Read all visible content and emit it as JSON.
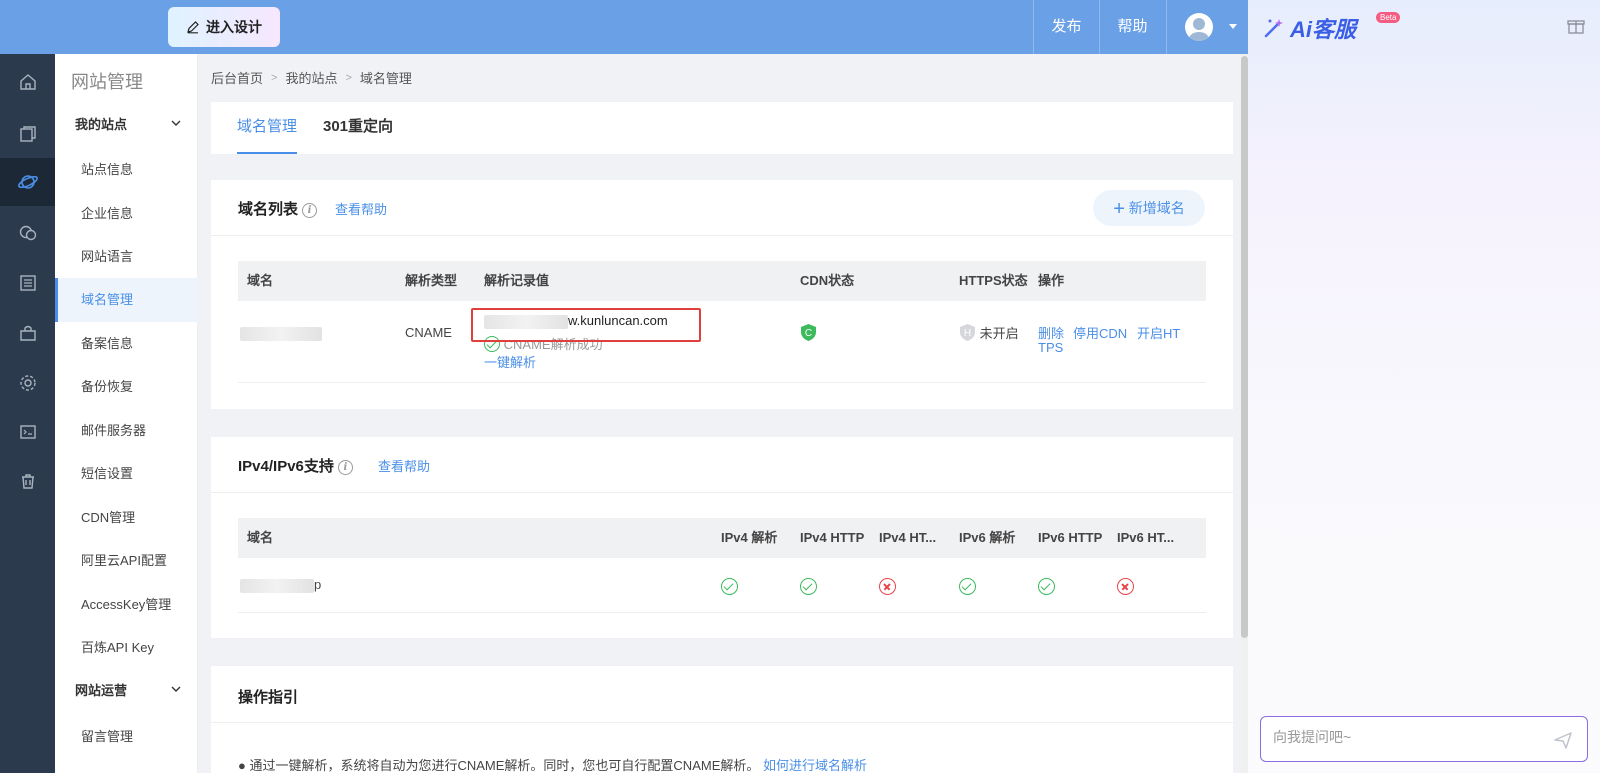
{
  "topbar": {
    "design_btn": "进入设计",
    "publish": "发布",
    "help": "帮助",
    "colors": {
      "bar": "#6aa0e6",
      "accent": "#4a8fe7"
    }
  },
  "iconbar": [
    "home-icon",
    "pages-icon",
    "planet-icon",
    "chat-icon",
    "list-icon",
    "store-icon",
    "gear-icon",
    "terminal-icon",
    "trash-icon"
  ],
  "subnav": {
    "title": "网站管理",
    "group1": "我的站点",
    "items": [
      "站点信息",
      "企业信息",
      "网站语言",
      "域名管理",
      "备案信息",
      "备份恢复",
      "邮件服务器",
      "短信设置",
      "CDN管理",
      "阿里云API配置",
      "AccessKey管理",
      "百炼API Key"
    ],
    "group2": "网站运营",
    "item_after": "留言管理"
  },
  "breadcrumb": [
    "后台首页",
    "我的站点",
    "域名管理"
  ],
  "tabs": [
    "域名管理",
    "301重定向"
  ],
  "domain_list": {
    "title": "域名列表",
    "help": "查看帮助",
    "add": "新增域名",
    "columns": [
      "域名",
      "解析类型",
      "解析记录值",
      "CDN状态",
      "HTTPS状态",
      "操作"
    ],
    "row": {
      "type": "CNAME",
      "record": "w.kunluncan.com",
      "status": "CNAME解析成功",
      "one_click": "一键解析",
      "cdn_badge": "C",
      "https_badge": "H",
      "https_state": "未开启",
      "actions": [
        "删除",
        "停用CDN",
        "开启HT",
        "TPS"
      ]
    }
  },
  "ipv": {
    "title": "IPv4/IPv6支持",
    "help": "查看帮助",
    "columns": [
      "域名",
      "IPv4 解析",
      "IPv4 HTTP",
      "IPv4 HT...",
      "IPv6 解析",
      "IPv6 HTTP",
      "IPv6 HT..."
    ],
    "row": {
      "domain_suffix": "p",
      "checks": [
        true,
        true,
        false,
        true,
        true,
        false
      ]
    }
  },
  "guide": {
    "title": "操作指引",
    "text": "● 通过一键解析，系统将自动为您进行CNAME解析。同时，您也可自行配置CNAME解析。",
    "link": "如何进行域名解析"
  },
  "ai": {
    "logo": "Ai客服",
    "beta": "Beta",
    "placeholder": "向我提问吧~"
  }
}
